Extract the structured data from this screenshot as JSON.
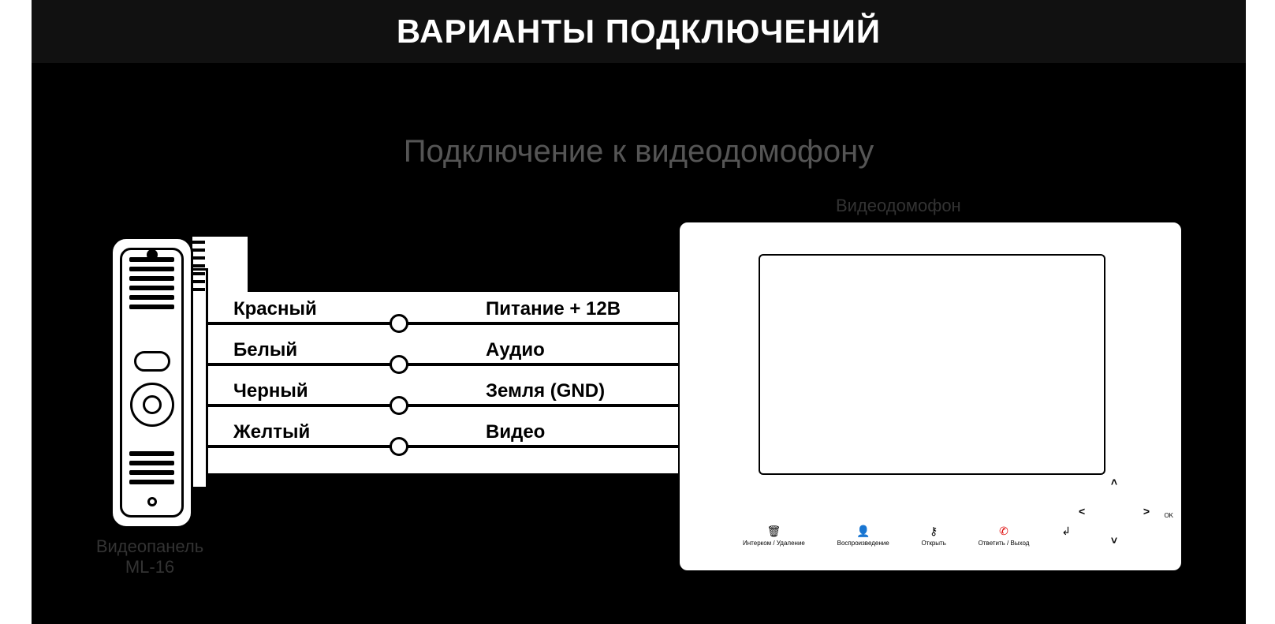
{
  "title": "ВАРИАНТЫ ПОДКЛЮЧЕНИЙ",
  "subtitle": "Подключение к видеодомофону",
  "monitor_label": "Видеодомофон",
  "panel_label_line1": "Видеопанель",
  "panel_label_line2": "ML-16",
  "wires": [
    {
      "color": "Красный",
      "signal": "Питание + 12В"
    },
    {
      "color": "Белый",
      "signal": "Аудио"
    },
    {
      "color": "Черный",
      "signal": "Земля (GND)"
    },
    {
      "color": "Желтый",
      "signal": "Видео"
    }
  ],
  "monitor_buttons": {
    "b1": "Интерком / Удаление",
    "b2": "Воспроизведение",
    "b3": "Открыть",
    "b4": "Ответить / Выход",
    "b5": "OK"
  },
  "icons": {
    "b1": "🗑",
    "b2": "👤",
    "b3": "⚷",
    "b4": "✆",
    "b5": "↲",
    "up": "˄",
    "down": "˅",
    "left": "<",
    "right": ">"
  }
}
